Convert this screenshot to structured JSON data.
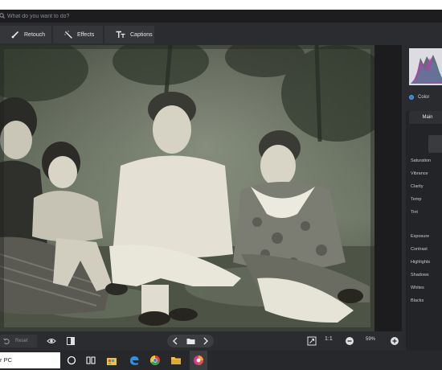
{
  "search": {
    "placeholder": "What do you want to do?"
  },
  "toolbar": {
    "retouch_label": "Retouch",
    "effects_label": "Effects",
    "captions_label": "Captions"
  },
  "panel": {
    "color_label": "Color",
    "main_tab_label": "Main",
    "sliders": [
      {
        "label": "Saturation"
      },
      {
        "label": "Vibrance"
      },
      {
        "label": "Clarity"
      },
      {
        "label": "Temp"
      },
      {
        "label": "Tint"
      },
      {
        "label": "Exposure"
      },
      {
        "label": "Contrast"
      },
      {
        "label": "Highlights"
      },
      {
        "label": "Shadows"
      },
      {
        "label": "Whites"
      },
      {
        "label": "Blacks"
      }
    ]
  },
  "bottombar": {
    "reset_label": "Reset",
    "ratio_label": "1:1",
    "zoom_label": "59%"
  },
  "taskbar": {
    "search_text": "r PC",
    "icons": [
      "cortana-icon",
      "task-view-icon",
      "store-icon",
      "edge-icon",
      "chrome-icon",
      "file-explorer-icon",
      "photo-app-icon"
    ]
  },
  "colors": {
    "accent": "#2f7fd0",
    "toolbar_bg": "#2b2c2f",
    "taskbar_bg": "#26282b"
  }
}
